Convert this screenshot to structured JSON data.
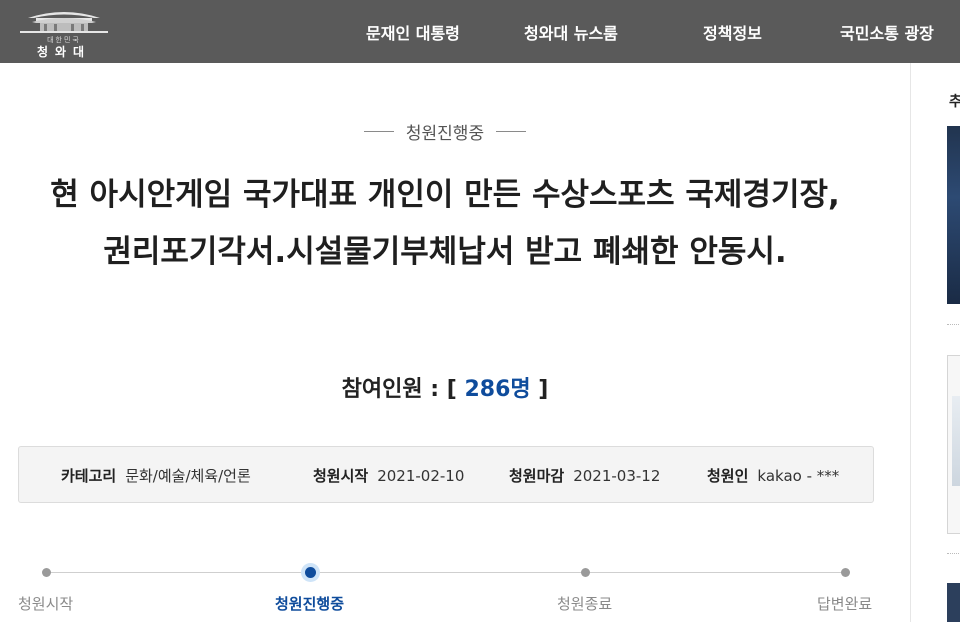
{
  "header": {
    "logo": {
      "sub": "대한민국",
      "name": "청와대"
    },
    "nav": [
      "문재인 대통령",
      "청와대 뉴스룸",
      "정책정보",
      "국민소통 광장"
    ]
  },
  "petition": {
    "status": "청원진행중",
    "title": "현 아시안게임 국가대표 개인이 만든 수상스포츠 국제경기장, 권리포기각서.시설물기부체납서 받고 폐쇄한 안동시.",
    "participants_label": "참여인원 : [ ",
    "participants_count": "286명",
    "participants_close": " ]",
    "info": {
      "category_label": "카테고리",
      "category": "문화/예술/체육/언론",
      "start_label": "청원시작",
      "start": "2021-02-10",
      "end_label": "청원마감",
      "end": "2021-03-12",
      "author_label": "청원인",
      "author": "kakao - ***"
    },
    "progress": [
      "청원시작",
      "청원진행중",
      "청원종료",
      "답변완료"
    ],
    "progress_current": 1
  },
  "sidebar": {
    "title": "추"
  },
  "colors": {
    "header_bg": "#5a5a5a",
    "accent": "#0f4c9c"
  }
}
